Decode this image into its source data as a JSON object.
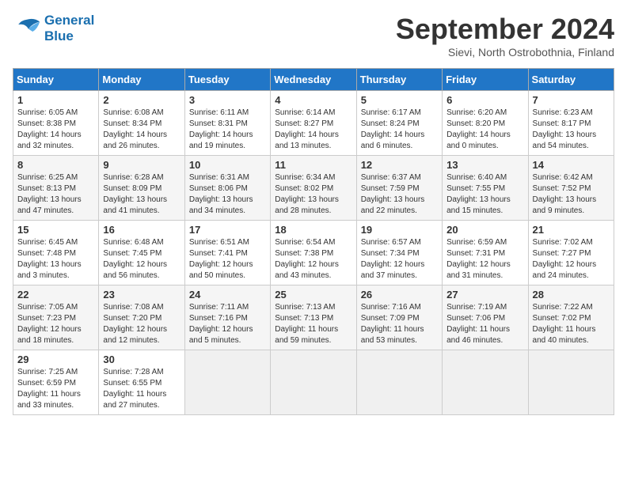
{
  "header": {
    "logo_line1": "General",
    "logo_line2": "Blue",
    "month": "September 2024",
    "location": "Sievi, North Ostrobothnia, Finland"
  },
  "weekdays": [
    "Sunday",
    "Monday",
    "Tuesday",
    "Wednesday",
    "Thursday",
    "Friday",
    "Saturday"
  ],
  "weeks": [
    [
      {
        "day": "1",
        "sunrise": "6:05 AM",
        "sunset": "8:38 PM",
        "daylight": "14 hours and 32 minutes."
      },
      {
        "day": "2",
        "sunrise": "6:08 AM",
        "sunset": "8:34 PM",
        "daylight": "14 hours and 26 minutes."
      },
      {
        "day": "3",
        "sunrise": "6:11 AM",
        "sunset": "8:31 PM",
        "daylight": "14 hours and 19 minutes."
      },
      {
        "day": "4",
        "sunrise": "6:14 AM",
        "sunset": "8:27 PM",
        "daylight": "14 hours and 13 minutes."
      },
      {
        "day": "5",
        "sunrise": "6:17 AM",
        "sunset": "8:24 PM",
        "daylight": "14 hours and 6 minutes."
      },
      {
        "day": "6",
        "sunrise": "6:20 AM",
        "sunset": "8:20 PM",
        "daylight": "14 hours and 0 minutes."
      },
      {
        "day": "7",
        "sunrise": "6:23 AM",
        "sunset": "8:17 PM",
        "daylight": "13 hours and 54 minutes."
      }
    ],
    [
      {
        "day": "8",
        "sunrise": "6:25 AM",
        "sunset": "8:13 PM",
        "daylight": "13 hours and 47 minutes."
      },
      {
        "day": "9",
        "sunrise": "6:28 AM",
        "sunset": "8:09 PM",
        "daylight": "13 hours and 41 minutes."
      },
      {
        "day": "10",
        "sunrise": "6:31 AM",
        "sunset": "8:06 PM",
        "daylight": "13 hours and 34 minutes."
      },
      {
        "day": "11",
        "sunrise": "6:34 AM",
        "sunset": "8:02 PM",
        "daylight": "13 hours and 28 minutes."
      },
      {
        "day": "12",
        "sunrise": "6:37 AM",
        "sunset": "7:59 PM",
        "daylight": "13 hours and 22 minutes."
      },
      {
        "day": "13",
        "sunrise": "6:40 AM",
        "sunset": "7:55 PM",
        "daylight": "13 hours and 15 minutes."
      },
      {
        "day": "14",
        "sunrise": "6:42 AM",
        "sunset": "7:52 PM",
        "daylight": "13 hours and 9 minutes."
      }
    ],
    [
      {
        "day": "15",
        "sunrise": "6:45 AM",
        "sunset": "7:48 PM",
        "daylight": "13 hours and 3 minutes."
      },
      {
        "day": "16",
        "sunrise": "6:48 AM",
        "sunset": "7:45 PM",
        "daylight": "12 hours and 56 minutes."
      },
      {
        "day": "17",
        "sunrise": "6:51 AM",
        "sunset": "7:41 PM",
        "daylight": "12 hours and 50 minutes."
      },
      {
        "day": "18",
        "sunrise": "6:54 AM",
        "sunset": "7:38 PM",
        "daylight": "12 hours and 43 minutes."
      },
      {
        "day": "19",
        "sunrise": "6:57 AM",
        "sunset": "7:34 PM",
        "daylight": "12 hours and 37 minutes."
      },
      {
        "day": "20",
        "sunrise": "6:59 AM",
        "sunset": "7:31 PM",
        "daylight": "12 hours and 31 minutes."
      },
      {
        "day": "21",
        "sunrise": "7:02 AM",
        "sunset": "7:27 PM",
        "daylight": "12 hours and 24 minutes."
      }
    ],
    [
      {
        "day": "22",
        "sunrise": "7:05 AM",
        "sunset": "7:23 PM",
        "daylight": "12 hours and 18 minutes."
      },
      {
        "day": "23",
        "sunrise": "7:08 AM",
        "sunset": "7:20 PM",
        "daylight": "12 hours and 12 minutes."
      },
      {
        "day": "24",
        "sunrise": "7:11 AM",
        "sunset": "7:16 PM",
        "daylight": "12 hours and 5 minutes."
      },
      {
        "day": "25",
        "sunrise": "7:13 AM",
        "sunset": "7:13 PM",
        "daylight": "11 hours and 59 minutes."
      },
      {
        "day": "26",
        "sunrise": "7:16 AM",
        "sunset": "7:09 PM",
        "daylight": "11 hours and 53 minutes."
      },
      {
        "day": "27",
        "sunrise": "7:19 AM",
        "sunset": "7:06 PM",
        "daylight": "11 hours and 46 minutes."
      },
      {
        "day": "28",
        "sunrise": "7:22 AM",
        "sunset": "7:02 PM",
        "daylight": "11 hours and 40 minutes."
      }
    ],
    [
      {
        "day": "29",
        "sunrise": "7:25 AM",
        "sunset": "6:59 PM",
        "daylight": "11 hours and 33 minutes."
      },
      {
        "day": "30",
        "sunrise": "7:28 AM",
        "sunset": "6:55 PM",
        "daylight": "11 hours and 27 minutes."
      },
      null,
      null,
      null,
      null,
      null
    ]
  ]
}
